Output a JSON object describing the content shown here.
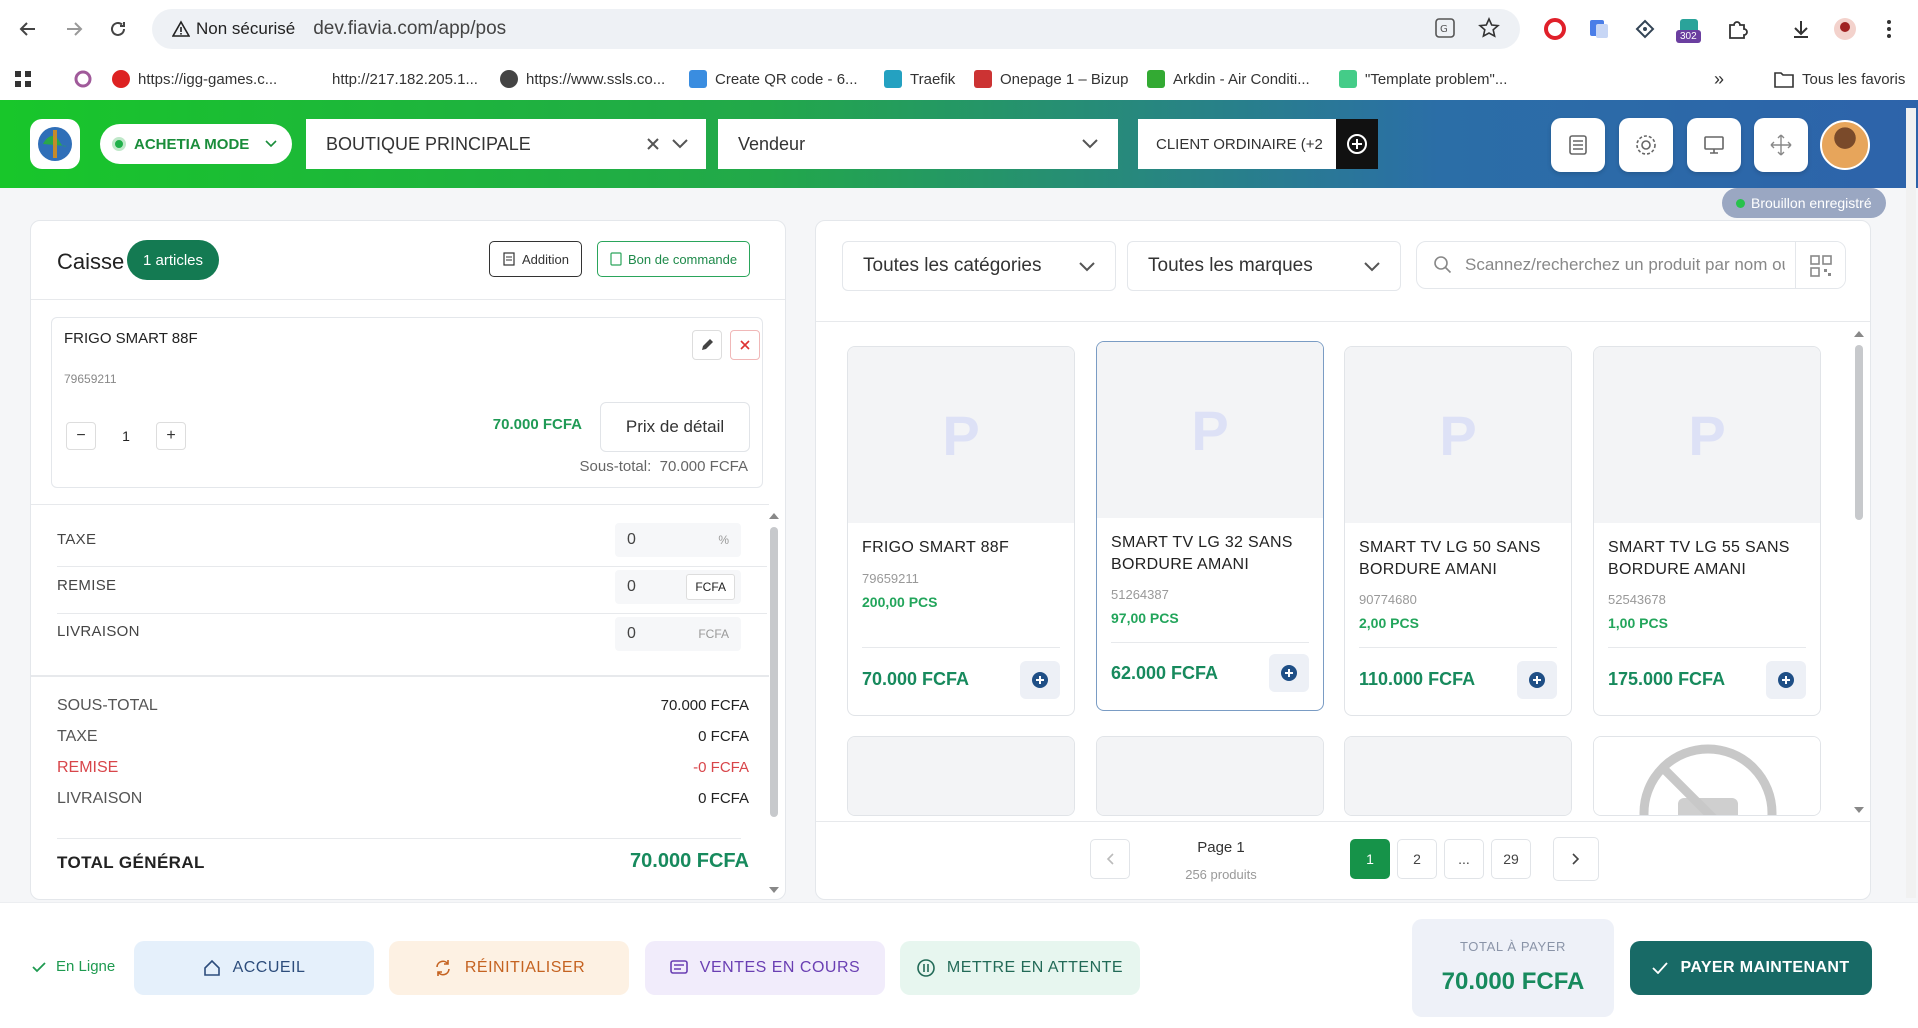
{
  "browser": {
    "security_label": "Non sécurisé",
    "url": "dev.fiavia.com/app/pos",
    "ext_badge": "302",
    "bookmarks": [
      {
        "label": "https://igg-games.c...",
        "color": "#d22"
      },
      {
        "label": "http://217.182.205.1...",
        "color": "#fff"
      },
      {
        "label": "https://www.ssls.co...",
        "color": "#444"
      },
      {
        "label": "Create QR code - 6...",
        "color": "#3a8de0"
      },
      {
        "label": "Traefik",
        "color": "#24a1c1"
      },
      {
        "label": "Onepage 1 – Bizup",
        "color": "#c33"
      },
      {
        "label": "Arkdin - Air Conditi...",
        "color": "#3a3"
      },
      {
        "label": "\"Template problem\"...",
        "color": "#4c8"
      }
    ],
    "more": "»",
    "all_favorites": "Tous les favoris"
  },
  "header": {
    "mode": "ACHETIA MODE",
    "store": "BOUTIQUE PRINCIPALE",
    "seller": "Vendeur",
    "client": "CLIENT ORDINAIRE (+2",
    "draft": "Brouillon enregistré"
  },
  "cart": {
    "title": "Caisse",
    "badge": "1 articles",
    "addition_btn": "Addition",
    "order_btn": "Bon de commande",
    "item": {
      "name": "FRIGO SMART 88F",
      "ref": "79659211",
      "qty": "1",
      "price": "70.000 FCFA",
      "price_type": "Prix de détail",
      "subtotal_label": "Sous-total:",
      "subtotal": "70.000 FCFA"
    },
    "tax_label": "TAXE",
    "tax_value": "0",
    "tax_unit": "%",
    "discount_label": "REMISE",
    "discount_value": "0",
    "discount_unit": "FCFA",
    "delivery_label": "LIVRAISON",
    "delivery_value": "0",
    "delivery_unit": "FCFA",
    "summary": {
      "subtotal_label": "SOUS-TOTAL",
      "subtotal": "70.000 FCFA",
      "tax_label": "TAXE",
      "tax": "0 FCFA",
      "discount_label": "REMISE",
      "discount": "-0 FCFA",
      "delivery_label": "LIVRAISON",
      "delivery": "0 FCFA",
      "total_label": "TOTAL GÉNÉRAL",
      "total": "70.000 FCFA"
    }
  },
  "products": {
    "category": "Toutes les catégories",
    "brand": "Toutes les marques",
    "search_placeholder": "Scannez/recherchez un produit par nom ou code",
    "placeholder_letter": "P",
    "items": [
      {
        "name": "FRIGO SMART 88F",
        "ref": "79659211",
        "stock": "200,00 PCS",
        "price": "70.000 FCFA"
      },
      {
        "name": "SMART TV LG 32 SANS BORDURE AMANI",
        "ref": "51264387",
        "stock": "97,00 PCS",
        "price": "62.000 FCFA"
      },
      {
        "name": "SMART TV LG 50 SANS BORDURE AMANI",
        "ref": "90774680",
        "stock": "2,00 PCS",
        "price": "110.000 FCFA"
      },
      {
        "name": "SMART TV LG 55 SANS BORDURE AMANI",
        "ref": "52543678",
        "stock": "1,00 PCS",
        "price": "175.000 FCFA"
      }
    ],
    "page_label": "Page 1",
    "count_label": "256 produits",
    "pages": [
      "1",
      "2",
      "...",
      "29"
    ]
  },
  "footer": {
    "status": "En Ligne",
    "home": "ACCUEIL",
    "reset": "RÉINITIALISER",
    "sales": "VENTES EN COURS",
    "hold": "METTRE EN ATTENTE",
    "total_label": "TOTAL À PAYER",
    "total": "70.000 FCFA",
    "pay": "PAYER MAINTENANT"
  }
}
